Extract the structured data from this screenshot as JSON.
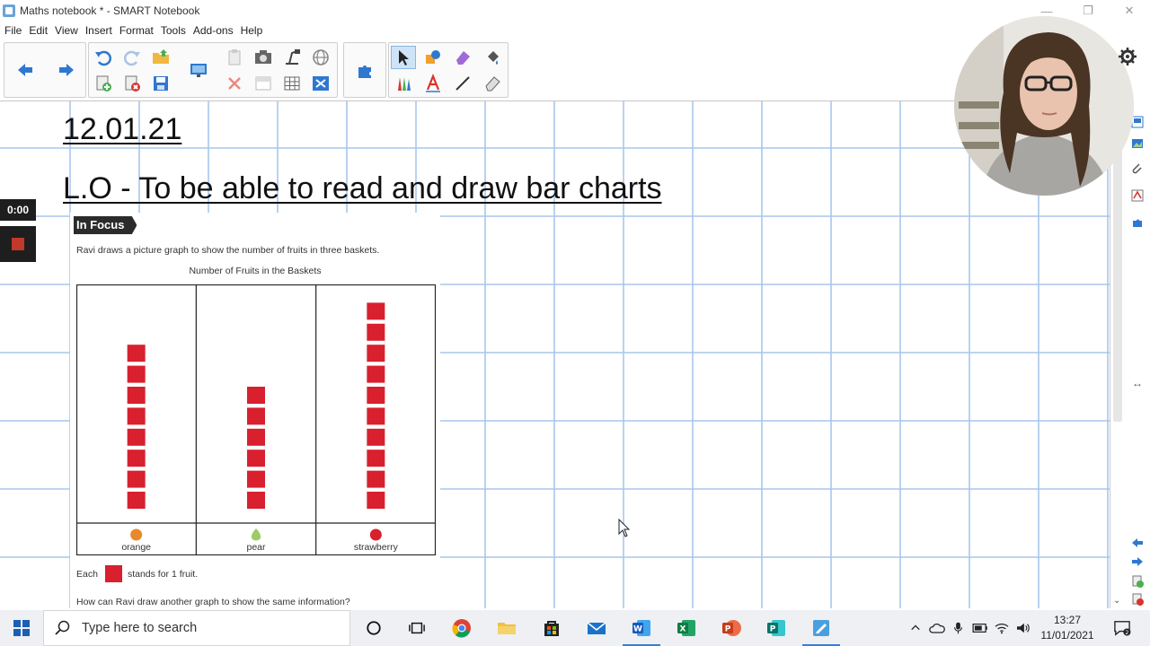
{
  "window": {
    "title": "Maths notebook * - SMART Notebook"
  },
  "menu": [
    "File",
    "Edit",
    "View",
    "Insert",
    "Format",
    "Tools",
    "Add-ons",
    "Help"
  ],
  "canvas": {
    "date": "12.01.21",
    "objective": "L.O - To be able to read and draw bar charts"
  },
  "book": {
    "badge": "In Focus",
    "intro": "Ravi draws a picture graph to show the number of fruits in three baskets.",
    "chart_title": "Number of Fruits in the Baskets",
    "key_prefix": "Each",
    "key_suffix": "stands for 1 fruit.",
    "question": "How can Ravi draw another graph to show the same information?"
  },
  "chart_data": {
    "type": "bar",
    "title": "Number of Fruits in the Baskets",
    "categories": [
      "orange",
      "pear",
      "strawberry"
    ],
    "values": [
      8,
      6,
      10
    ],
    "ylim": [
      0,
      10
    ],
    "grid": false,
    "colors": {
      "block": "#d8202e",
      "orange": "#e8892b",
      "pear": "#9ccc65",
      "strawberry": "#d8202e"
    }
  },
  "recording": {
    "timer": "0:00"
  },
  "taskbar": {
    "search_placeholder": "Type here to search",
    "time": "13:27",
    "date": "11/01/2021"
  },
  "colors": {
    "grid": "#a9c6ec",
    "accent": "#3b7dd8",
    "block": "#d8202e"
  }
}
